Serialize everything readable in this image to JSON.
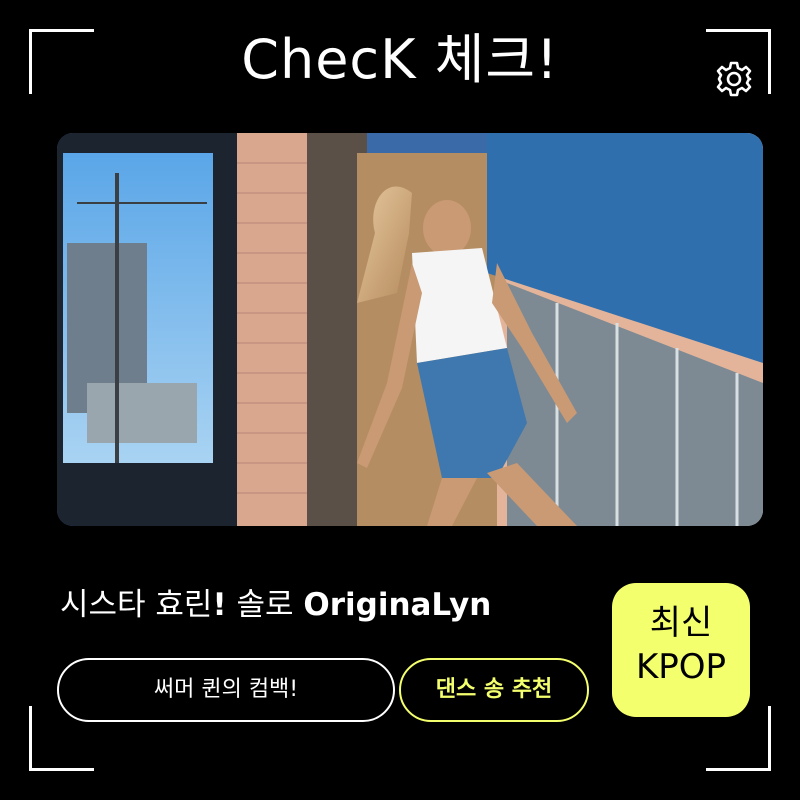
{
  "title": "ChecK 체크!",
  "icons": {
    "settings": "gear-icon"
  },
  "photo": {
    "alt": "photo"
  },
  "headline": {
    "part1": "시스타 효린",
    "part2": "!",
    "part3": " 솔로 ",
    "part4": "OriginaLyn"
  },
  "buttons": {
    "comeback": "써머 퀸의 컴백!",
    "dance": "댄스 송 추천"
  },
  "badge": {
    "line1": "최신",
    "line2": "KPOP"
  },
  "colors": {
    "accent": "#f4ff6e",
    "background": "#000000",
    "foreground": "#ffffff"
  }
}
